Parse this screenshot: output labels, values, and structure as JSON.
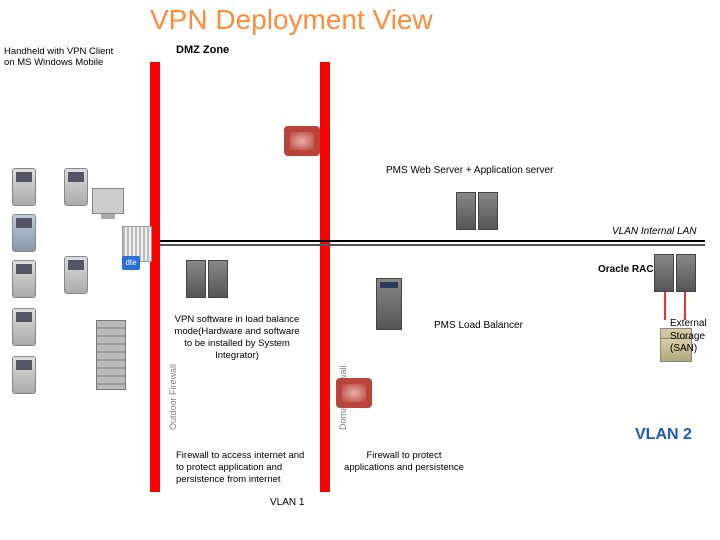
{
  "title": "VPN Deployment View",
  "handheld_label": "Handheld with VPN Client on MS Windows Mobile",
  "dmz_zone": "DMZ Zone",
  "firewall_outdoor_label": "Outdoor Firewall",
  "firewall_domain_label": "Domain Firewall",
  "pms_web_label": "PMS Web Server + Application server",
  "vlan_internal": "VLAN Internal LAN",
  "oracle_rac": "Oracle RAC",
  "vpn_box": "VPN software in load balance mode(Hardware and software to be installed by System Integrator)",
  "pms_lb": "PMS Load Balancer",
  "ext_storage": "External Storage (SAN)",
  "fw_internet": "Firewall to access internet and to protect  application and persistence from internet",
  "fw_apps": "Firewall to protect applications and persistence",
  "vlan1": "VLAN 1",
  "vlan2": "VLAN 2",
  "dte": "dte"
}
